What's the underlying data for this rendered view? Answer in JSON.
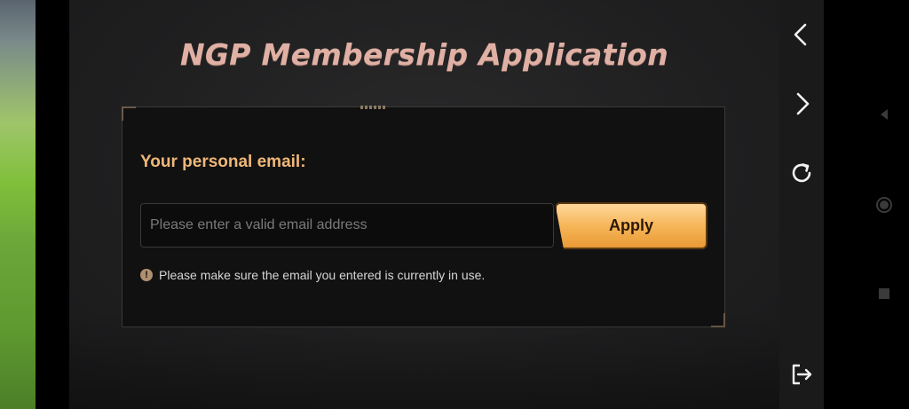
{
  "page": {
    "title": "NGP Membership Application"
  },
  "form": {
    "email_label": "Your personal email:",
    "email_value": "",
    "email_placeholder": "Please enter a valid email address",
    "apply_label": "Apply",
    "notice": "Please make sure the email you entered is currently in use."
  },
  "nav_icons": [
    "back-chevron-icon",
    "forward-chevron-icon",
    "refresh-icon",
    "exit-icon"
  ],
  "system_icons": [
    "android-back-icon",
    "android-home-icon",
    "android-recents-icon"
  ],
  "colors": {
    "title": "#e0b0a4",
    "label": "#f0b878",
    "accent_button": "#f6b659",
    "panel_bg": "#1f1f20",
    "card_bg": "#111112"
  }
}
